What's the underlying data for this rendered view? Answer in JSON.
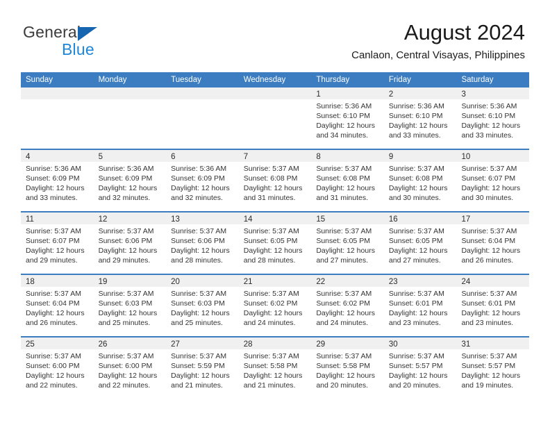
{
  "brand": {
    "name_part1": "General",
    "name_part2": "Blue"
  },
  "header": {
    "title": "August 2024",
    "subtitle": "Canlaon, Central Visayas, Philippines"
  },
  "colors": {
    "header_blue": "#3b7dc0",
    "logo_blue": "#1f86d8",
    "daynum_band": "#f0f0f0"
  },
  "weekday_headers": [
    "Sunday",
    "Monday",
    "Tuesday",
    "Wednesday",
    "Thursday",
    "Friday",
    "Saturday"
  ],
  "weeks": [
    [
      {
        "day": "",
        "empty": true
      },
      {
        "day": "",
        "empty": true
      },
      {
        "day": "",
        "empty": true
      },
      {
        "day": "",
        "empty": true
      },
      {
        "day": "1",
        "sunrise": "Sunrise: 5:36 AM",
        "sunset": "Sunset: 6:10 PM",
        "daylight1": "Daylight: 12 hours",
        "daylight2": "and 34 minutes."
      },
      {
        "day": "2",
        "sunrise": "Sunrise: 5:36 AM",
        "sunset": "Sunset: 6:10 PM",
        "daylight1": "Daylight: 12 hours",
        "daylight2": "and 33 minutes."
      },
      {
        "day": "3",
        "sunrise": "Sunrise: 5:36 AM",
        "sunset": "Sunset: 6:10 PM",
        "daylight1": "Daylight: 12 hours",
        "daylight2": "and 33 minutes."
      }
    ],
    [
      {
        "day": "4",
        "sunrise": "Sunrise: 5:36 AM",
        "sunset": "Sunset: 6:09 PM",
        "daylight1": "Daylight: 12 hours",
        "daylight2": "and 33 minutes."
      },
      {
        "day": "5",
        "sunrise": "Sunrise: 5:36 AM",
        "sunset": "Sunset: 6:09 PM",
        "daylight1": "Daylight: 12 hours",
        "daylight2": "and 32 minutes."
      },
      {
        "day": "6",
        "sunrise": "Sunrise: 5:36 AM",
        "sunset": "Sunset: 6:09 PM",
        "daylight1": "Daylight: 12 hours",
        "daylight2": "and 32 minutes."
      },
      {
        "day": "7",
        "sunrise": "Sunrise: 5:37 AM",
        "sunset": "Sunset: 6:08 PM",
        "daylight1": "Daylight: 12 hours",
        "daylight2": "and 31 minutes."
      },
      {
        "day": "8",
        "sunrise": "Sunrise: 5:37 AM",
        "sunset": "Sunset: 6:08 PM",
        "daylight1": "Daylight: 12 hours",
        "daylight2": "and 31 minutes."
      },
      {
        "day": "9",
        "sunrise": "Sunrise: 5:37 AM",
        "sunset": "Sunset: 6:08 PM",
        "daylight1": "Daylight: 12 hours",
        "daylight2": "and 30 minutes."
      },
      {
        "day": "10",
        "sunrise": "Sunrise: 5:37 AM",
        "sunset": "Sunset: 6:07 PM",
        "daylight1": "Daylight: 12 hours",
        "daylight2": "and 30 minutes."
      }
    ],
    [
      {
        "day": "11",
        "sunrise": "Sunrise: 5:37 AM",
        "sunset": "Sunset: 6:07 PM",
        "daylight1": "Daylight: 12 hours",
        "daylight2": "and 29 minutes."
      },
      {
        "day": "12",
        "sunrise": "Sunrise: 5:37 AM",
        "sunset": "Sunset: 6:06 PM",
        "daylight1": "Daylight: 12 hours",
        "daylight2": "and 29 minutes."
      },
      {
        "day": "13",
        "sunrise": "Sunrise: 5:37 AM",
        "sunset": "Sunset: 6:06 PM",
        "daylight1": "Daylight: 12 hours",
        "daylight2": "and 28 minutes."
      },
      {
        "day": "14",
        "sunrise": "Sunrise: 5:37 AM",
        "sunset": "Sunset: 6:05 PM",
        "daylight1": "Daylight: 12 hours",
        "daylight2": "and 28 minutes."
      },
      {
        "day": "15",
        "sunrise": "Sunrise: 5:37 AM",
        "sunset": "Sunset: 6:05 PM",
        "daylight1": "Daylight: 12 hours",
        "daylight2": "and 27 minutes."
      },
      {
        "day": "16",
        "sunrise": "Sunrise: 5:37 AM",
        "sunset": "Sunset: 6:05 PM",
        "daylight1": "Daylight: 12 hours",
        "daylight2": "and 27 minutes."
      },
      {
        "day": "17",
        "sunrise": "Sunrise: 5:37 AM",
        "sunset": "Sunset: 6:04 PM",
        "daylight1": "Daylight: 12 hours",
        "daylight2": "and 26 minutes."
      }
    ],
    [
      {
        "day": "18",
        "sunrise": "Sunrise: 5:37 AM",
        "sunset": "Sunset: 6:04 PM",
        "daylight1": "Daylight: 12 hours",
        "daylight2": "and 26 minutes."
      },
      {
        "day": "19",
        "sunrise": "Sunrise: 5:37 AM",
        "sunset": "Sunset: 6:03 PM",
        "daylight1": "Daylight: 12 hours",
        "daylight2": "and 25 minutes."
      },
      {
        "day": "20",
        "sunrise": "Sunrise: 5:37 AM",
        "sunset": "Sunset: 6:03 PM",
        "daylight1": "Daylight: 12 hours",
        "daylight2": "and 25 minutes."
      },
      {
        "day": "21",
        "sunrise": "Sunrise: 5:37 AM",
        "sunset": "Sunset: 6:02 PM",
        "daylight1": "Daylight: 12 hours",
        "daylight2": "and 24 minutes."
      },
      {
        "day": "22",
        "sunrise": "Sunrise: 5:37 AM",
        "sunset": "Sunset: 6:02 PM",
        "daylight1": "Daylight: 12 hours",
        "daylight2": "and 24 minutes."
      },
      {
        "day": "23",
        "sunrise": "Sunrise: 5:37 AM",
        "sunset": "Sunset: 6:01 PM",
        "daylight1": "Daylight: 12 hours",
        "daylight2": "and 23 minutes."
      },
      {
        "day": "24",
        "sunrise": "Sunrise: 5:37 AM",
        "sunset": "Sunset: 6:01 PM",
        "daylight1": "Daylight: 12 hours",
        "daylight2": "and 23 minutes."
      }
    ],
    [
      {
        "day": "25",
        "sunrise": "Sunrise: 5:37 AM",
        "sunset": "Sunset: 6:00 PM",
        "daylight1": "Daylight: 12 hours",
        "daylight2": "and 22 minutes."
      },
      {
        "day": "26",
        "sunrise": "Sunrise: 5:37 AM",
        "sunset": "Sunset: 6:00 PM",
        "daylight1": "Daylight: 12 hours",
        "daylight2": "and 22 minutes."
      },
      {
        "day": "27",
        "sunrise": "Sunrise: 5:37 AM",
        "sunset": "Sunset: 5:59 PM",
        "daylight1": "Daylight: 12 hours",
        "daylight2": "and 21 minutes."
      },
      {
        "day": "28",
        "sunrise": "Sunrise: 5:37 AM",
        "sunset": "Sunset: 5:58 PM",
        "daylight1": "Daylight: 12 hours",
        "daylight2": "and 21 minutes."
      },
      {
        "day": "29",
        "sunrise": "Sunrise: 5:37 AM",
        "sunset": "Sunset: 5:58 PM",
        "daylight1": "Daylight: 12 hours",
        "daylight2": "and 20 minutes."
      },
      {
        "day": "30",
        "sunrise": "Sunrise: 5:37 AM",
        "sunset": "Sunset: 5:57 PM",
        "daylight1": "Daylight: 12 hours",
        "daylight2": "and 20 minutes."
      },
      {
        "day": "31",
        "sunrise": "Sunrise: 5:37 AM",
        "sunset": "Sunset: 5:57 PM",
        "daylight1": "Daylight: 12 hours",
        "daylight2": "and 19 minutes."
      }
    ]
  ]
}
